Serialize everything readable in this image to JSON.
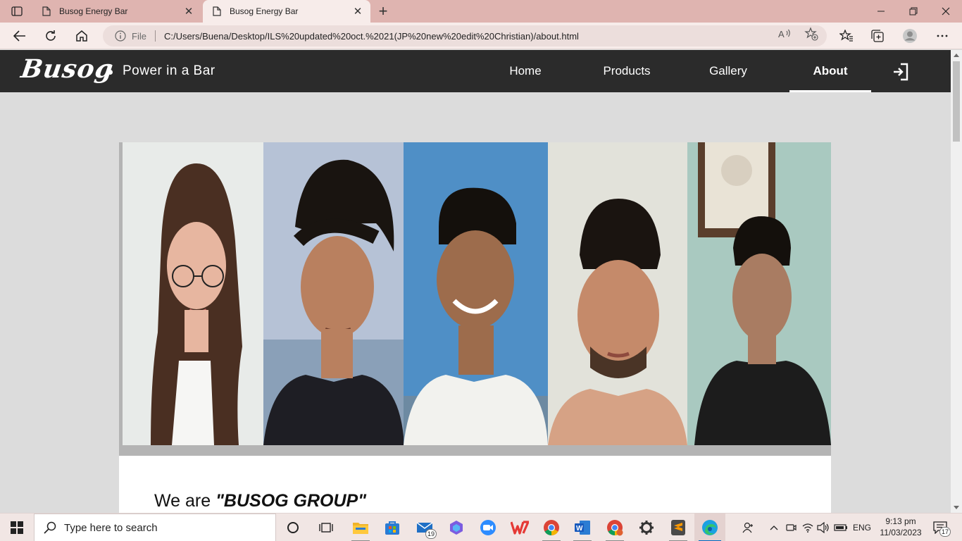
{
  "browser": {
    "tabs": [
      {
        "title": "Busog Energy Bar",
        "active": false
      },
      {
        "title": "Busog Energy Bar",
        "active": true
      }
    ],
    "address": {
      "scheme_label": "File",
      "url": "C:/Users/Buena/Desktop/ILS%20updated%20oct.%2021(JP%20new%20edit%20Christian)/about.html"
    }
  },
  "site": {
    "logo_text": "Busog",
    "tagline": "Power in a Bar",
    "nav": [
      {
        "label": "Home",
        "active": false
      },
      {
        "label": "Products",
        "active": false
      },
      {
        "label": "Gallery",
        "active": false
      },
      {
        "label": "About",
        "active": true
      }
    ],
    "intro_prefix": "We are ",
    "intro_name": "\"BUSOG GROUP\""
  },
  "taskbar": {
    "search_placeholder": "Type here to search",
    "mail_badge": "19",
    "language": "ENG",
    "time": "9:13 pm",
    "date": "11/03/2023",
    "notification_count": "17"
  },
  "colors": {
    "tabstrip": "#dfb4b0",
    "toolbar": "#f7ecea",
    "site_nav": "#2b2b2b",
    "page_bg": "#dcdcdc"
  }
}
